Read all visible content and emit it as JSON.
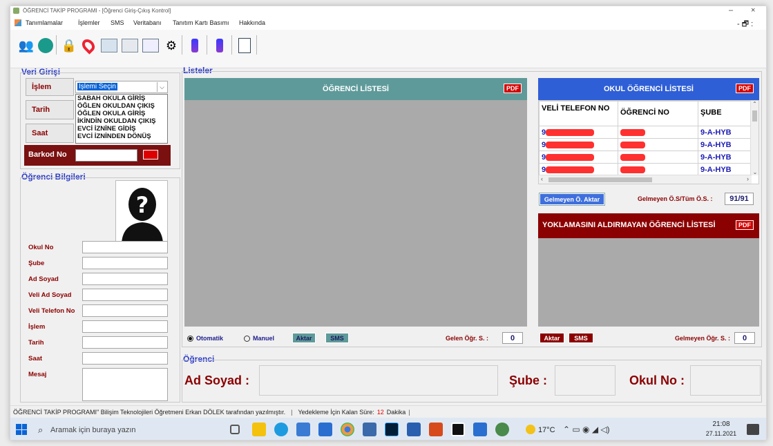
{
  "window": {
    "title": "ÖĞRENCİ TAKİP PROGRAMI - [Öğrenci Giriş-Çıkış Kontrol]",
    "minimize": "–",
    "close": "×",
    "restore": "- 🗗 :"
  },
  "menu": [
    "Tanımlamalar",
    "İşlemler",
    "SMS",
    "Veritabanı",
    "Tanıtım Kartı Basımı",
    "Hakkında"
  ],
  "veri_girisi": {
    "title": "Veri Girişi",
    "islem_label": "İşlem",
    "islem_value": "İşlemi Seçin",
    "tarih_label": "Tarih",
    "saat_label": "Saat",
    "barkod_label": "Barkod No",
    "options": [
      "SABAH OKULA GİRİŞ",
      "ÖĞLEN OKULDAN ÇIKIŞ",
      "ÖĞLEN OKULA GİRİŞ",
      "İKİNDİN OKULDAN ÇIKIŞ",
      "EVCİ İZNİNE GİDİŞ",
      "EVCİ İZNİNDEN DÖNÜŞ"
    ],
    "barkod_btn": "Ara"
  },
  "ogrenci_bilgileri": {
    "title": "Öğrenci Bilgileri",
    "fields": [
      "Okul No",
      "Şube",
      "Ad Soyad",
      "Veli Ad Soyad",
      "Veli Telefon No",
      "İşlem",
      "Tarih",
      "Saat",
      "Mesaj"
    ]
  },
  "listeler": {
    "title": "Listeler",
    "ogrenci_listesi": "ÖĞRENCİ LİSTESİ",
    "pdf": "PDF",
    "otomatik": "Otomatik",
    "manuel": "Manuel",
    "aktar": "Aktar",
    "sms": "SMS",
    "gelen_label": "Gelen Öğr. S. :",
    "gelen_value": "0"
  },
  "okul_listesi": {
    "title": "OKUL ÖĞRENCİ LİSTESİ",
    "columns": [
      "VELİ TELEFON NO",
      "ÖĞRENCİ NO",
      "ŞUBE"
    ],
    "rows": [
      {
        "tel": "9",
        "sube": "9-A-HYB"
      },
      {
        "tel": "9",
        "sube": "9-A-HYB"
      },
      {
        "tel": "9",
        "sube": "9-A-HYB"
      },
      {
        "tel": "9",
        "sube": "9-A-HYB"
      }
    ],
    "gelmeyen_aktar": "Gelmeyen Ö. Aktar",
    "ratio_label": "Gelmeyen Ö.S/Tüm Ö.S. :",
    "ratio_value": "91/91"
  },
  "yoklama": {
    "title": "YOKLAMASINI ALDIRMAYAN ÖĞRENCİ LİSTESİ",
    "aktar": "Aktar",
    "sms": "SMS",
    "gelmeyen_label": "Gelmeyen Öğr. S. :",
    "gelmeyen_value": "0"
  },
  "ogrenci": {
    "title": "Öğrenci",
    "ad_soyad": "Ad Soyad :",
    "sube": "Şube :",
    "okul_no": "Okul No :"
  },
  "status": {
    "credit": "ÖĞRENCİ TAKİP PROGRAMI\" Bilişim Teknolojileri Öğretmeni Erkan DÖLEK tarafından yazılmıştır.",
    "backup_label": "Yedekleme İçin Kalan Süre:",
    "backup_value": "12",
    "backup_unit": "Dakika"
  },
  "taskbar": {
    "search_placeholder": "Aramak için buraya yazın",
    "temp": "17°C",
    "time": "21:08",
    "date": "27.11.2021"
  }
}
